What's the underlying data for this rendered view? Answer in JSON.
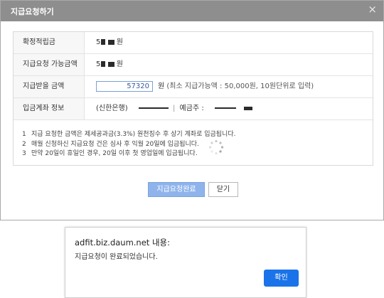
{
  "dialog": {
    "title": "지급요청하기",
    "close_glyph": "×",
    "rows": {
      "confirmed": {
        "label": "확정적립금",
        "value_prefix": "5",
        "unit": "원"
      },
      "available": {
        "label": "지급요청 가능금액",
        "value_prefix": "5",
        "unit": "원"
      },
      "amount": {
        "label": "지급받을 금액",
        "input_value": "57320",
        "unit": "원",
        "hint": "(최소 지급가능액 : 50,000원, 10원단위로 입력)"
      },
      "account": {
        "label": "입금계좌 정보",
        "bank": "(신한은행)",
        "holder_label": "예금주 :"
      }
    },
    "notes": [
      {
        "num": "1",
        "text": "지급 요청한 금액은 제세공과금(3.3%) 원천징수 후 상기 계좌로 입금됩니다."
      },
      {
        "num": "2",
        "text": "매월 신청하신 지급요청 건은 심사 후 익월 20일에 입금됩니다."
      },
      {
        "num": "3",
        "text": "만약 20일이 휴일인 경우, 20일 이후 첫 영업일에 입금됩니다."
      }
    ],
    "buttons": {
      "complete": "지급요청완료",
      "close": "닫기"
    }
  },
  "alert": {
    "origin": "adfit.biz.daum.net 내용:",
    "message": "지급요청이 완료되었습니다.",
    "ok": "확인"
  },
  "colors": {
    "header_bg": "#8e8e8e",
    "primary_button": "#8fb4ec",
    "alert_button": "#1a73e8"
  }
}
